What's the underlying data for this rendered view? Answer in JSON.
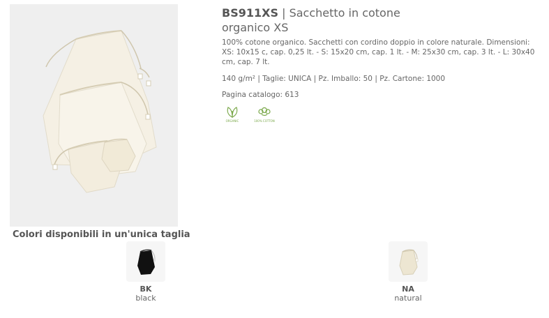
{
  "product": {
    "code": "BS911XS",
    "separator": "|",
    "name_line1": "Sacchetto in cotone",
    "name_line2": "organico XS",
    "description": "100% cotone organico. Sacchetti con cordino doppio in colore naturale. Dimensioni: XS: 10x15 c, cap. 0,25 lt. - S: 15x20 cm, cap. 1 lt. - M: 25x30 cm, cap. 3 lt. - L: 30x40 cm, cap. 7 lt.",
    "specs": "140 g/m² | Taglie: UNICA | Pz. Imballo: 50 | Pz. Cartone: 1000",
    "catalog": "Pagina catalogo: 613",
    "badges": [
      {
        "icon": "organic-leaf-icon",
        "caption": "ORGANIC",
        "color": "#7aa84a"
      },
      {
        "icon": "cotton-flower-icon",
        "caption": "100% COTTON",
        "color": "#7aa84a"
      }
    ]
  },
  "colors": {
    "title": "Colori disponibili in un'unica taglia",
    "swatches": [
      {
        "code": "BK",
        "name": "black",
        "hex": "#111111"
      },
      {
        "code": "NA",
        "name": "natural",
        "hex": "#ede6d2"
      }
    ]
  }
}
